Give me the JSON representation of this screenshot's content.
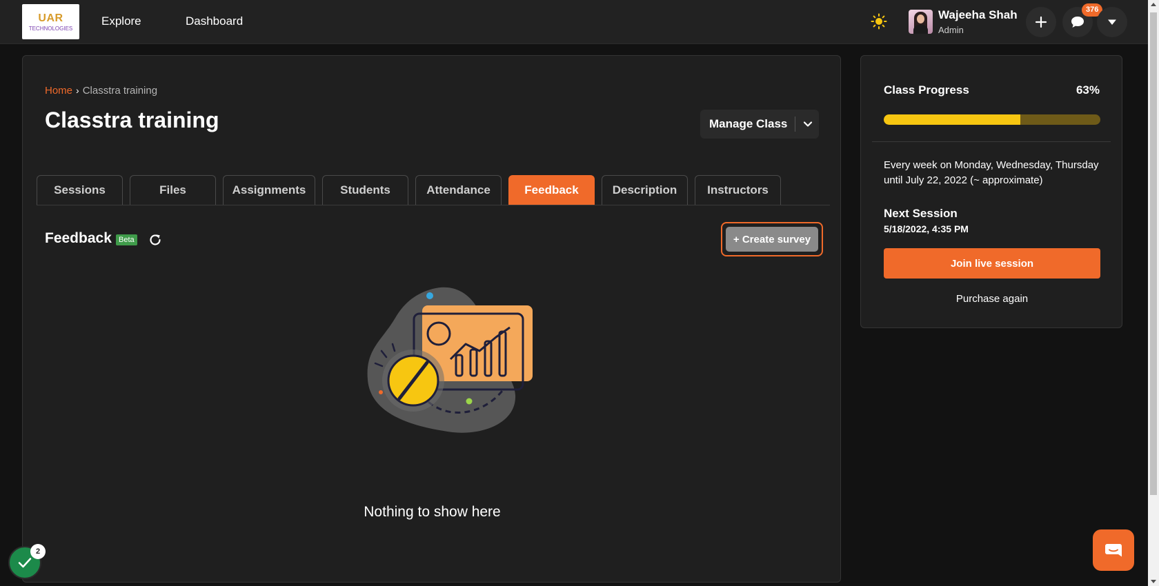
{
  "header": {
    "logo_text_line1": "UAR",
    "logo_text_line2": "TECHNOLOGIES",
    "nav": [
      {
        "label": "Explore"
      },
      {
        "label": "Dashboard"
      }
    ],
    "user": {
      "name": "Wajeeha Shah",
      "role": "Admin"
    },
    "messages_badge": "376",
    "icons": [
      "sun-icon",
      "plus-icon",
      "chat-bubble-icon",
      "caret-down-icon"
    ]
  },
  "breadcrumb": {
    "home": "Home",
    "separator": "›",
    "current": "Classtra training"
  },
  "page_title": "Classtra training",
  "manage_class_label": "Manage Class",
  "tabs": [
    {
      "label": "Sessions",
      "active": false
    },
    {
      "label": "Files",
      "active": false
    },
    {
      "label": "Assignments",
      "active": false
    },
    {
      "label": "Students",
      "active": false
    },
    {
      "label": "Attendance",
      "active": false
    },
    {
      "label": "Feedback",
      "active": true
    },
    {
      "label": "Description",
      "active": false
    },
    {
      "label": "Instructors",
      "active": false
    }
  ],
  "feedback": {
    "title": "Feedback",
    "beta_label": "Beta",
    "create_survey_label": "+ Create survey",
    "empty_message": "Nothing to show here"
  },
  "sidebar": {
    "progress_label": "Class Progress",
    "progress_value_text": "63%",
    "progress_fraction": 0.63,
    "schedule_text": "Every week on Monday, Wednesday, Thursday until July 22, 2022 (~ approximate)",
    "next_session_label": "Next Session",
    "next_session_value": "5/18/2022, 4:35 PM",
    "join_label": "Join live session",
    "purchase_label": "Purchase again"
  },
  "floating": {
    "checklist_badge": "2"
  },
  "colors": {
    "accent": "#f06a2a",
    "progress": "#f7c611",
    "beta": "#3f9b4a",
    "background": "#121212",
    "card": "#1f1f1f"
  }
}
